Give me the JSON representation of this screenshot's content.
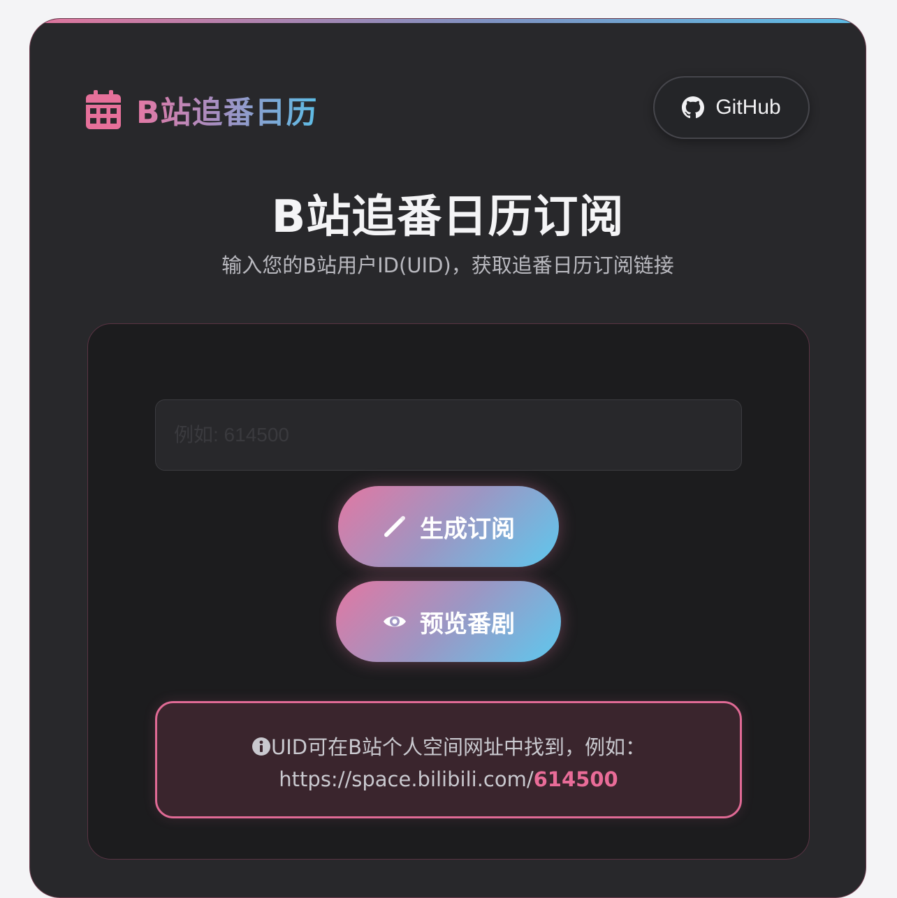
{
  "header": {
    "logo_text": "B站追番日历",
    "github_label": "GitHub"
  },
  "main": {
    "title": "B站追番日历订阅",
    "subtitle": "输入您的B站用户ID(UID)，获取追番日历订阅链接"
  },
  "form": {
    "uid_placeholder": "例如: 614500",
    "uid_value": "",
    "generate_label": "生成订阅",
    "preview_label": "预览番剧"
  },
  "info": {
    "line1": "UID可在B站个人空间网址中找到，例如：",
    "url_prefix": "https://space.bilibili.com/",
    "url_uid": "614500"
  },
  "icons": {
    "logo": "calendar-icon",
    "github": "github-icon",
    "generate": "magic-wand-icon",
    "preview": "eye-icon",
    "info": "info-circle-icon"
  },
  "colors": {
    "accent_pink": "#e277a2",
    "accent_blue": "#5ec8ee",
    "card_bg": "#28282b",
    "panel_bg": "#1c1c1e"
  }
}
